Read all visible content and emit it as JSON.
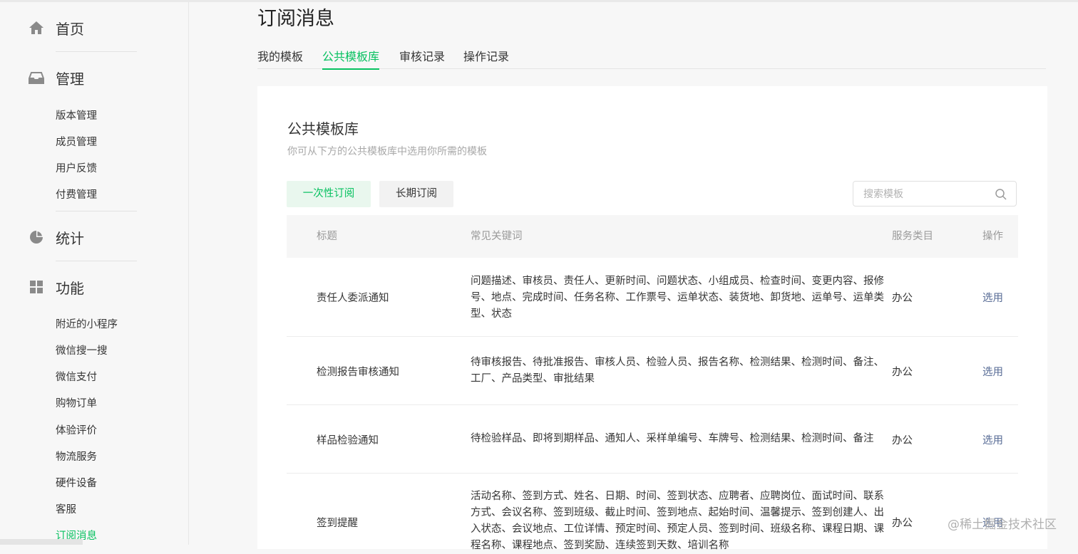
{
  "sidebar": {
    "home": {
      "label": "首页",
      "icon": "home-icon"
    },
    "manage": {
      "label": "管理",
      "icon": "inbox-icon",
      "items": [
        "版本管理",
        "成员管理",
        "用户反馈",
        "付费管理"
      ]
    },
    "stats": {
      "label": "统计",
      "icon": "pie-chart-icon"
    },
    "features": {
      "label": "功能",
      "icon": "grid-icon",
      "items": [
        "附近的小程序",
        "微信搜一搜",
        "微信支付",
        "购物订单",
        "体验评价",
        "物流服务",
        "硬件设备",
        "客服",
        "订阅消息"
      ],
      "active": "订阅消息"
    }
  },
  "page": {
    "title": "订阅消息",
    "tabs": [
      "我的模板",
      "公共模板库",
      "审核记录",
      "操作记录"
    ],
    "active_tab": "公共模板库"
  },
  "panel": {
    "title": "公共模板库",
    "description": "你可从下方的公共模板库中选用你所需的模板",
    "segments": [
      "一次性订阅",
      "长期订阅"
    ],
    "active_segment": "一次性订阅",
    "search_placeholder": "搜索模板"
  },
  "table": {
    "headers": [
      "标题",
      "常见关键词",
      "服务类目",
      "操作"
    ],
    "rows": [
      {
        "title": "责任人委派通知",
        "keywords": "问题描述、审核员、责任人、更新时间、问题状态、小组成员、检查时间、变更内容、报修号、地点、完成时间、任务名称、工作票号、运单状态、装货地、卸货地、运单号、运单类型、状态",
        "category": "办公",
        "action": "选用"
      },
      {
        "title": "检测报告审核通知",
        "keywords": "待审核报告、待批准报告、审核人员、检验人员、报告名称、检测结果、检测时间、备注、工厂、产品类型、审批结果",
        "category": "办公",
        "action": "选用"
      },
      {
        "title": "样品检验通知",
        "keywords": "待检验样品、即将到期样品、通知人、采样单编号、车牌号、检测结果、检测时间、备注",
        "category": "办公",
        "action": "选用"
      },
      {
        "title": "签到提醒",
        "keywords": "活动名称、签到方式、姓名、日期、时间、签到状态、应聘者、应聘岗位、面试时间、联系方式、会议名称、签到班级、截止时间、签到地点、起始时间、温馨提示、签到创建人、出入状态、会议地点、工位详情、预定时间、预定人员、签到时间、班级名称、课程日期、课程名称、课程地点、签到奖励、连续签到天数、培训名称",
        "category": "办公",
        "action": "选用"
      }
    ]
  },
  "watermark": "@稀土掘金技术社区",
  "colors": {
    "accent": "#07c160",
    "link": "#576b95",
    "muted": "#9b9b9b"
  }
}
